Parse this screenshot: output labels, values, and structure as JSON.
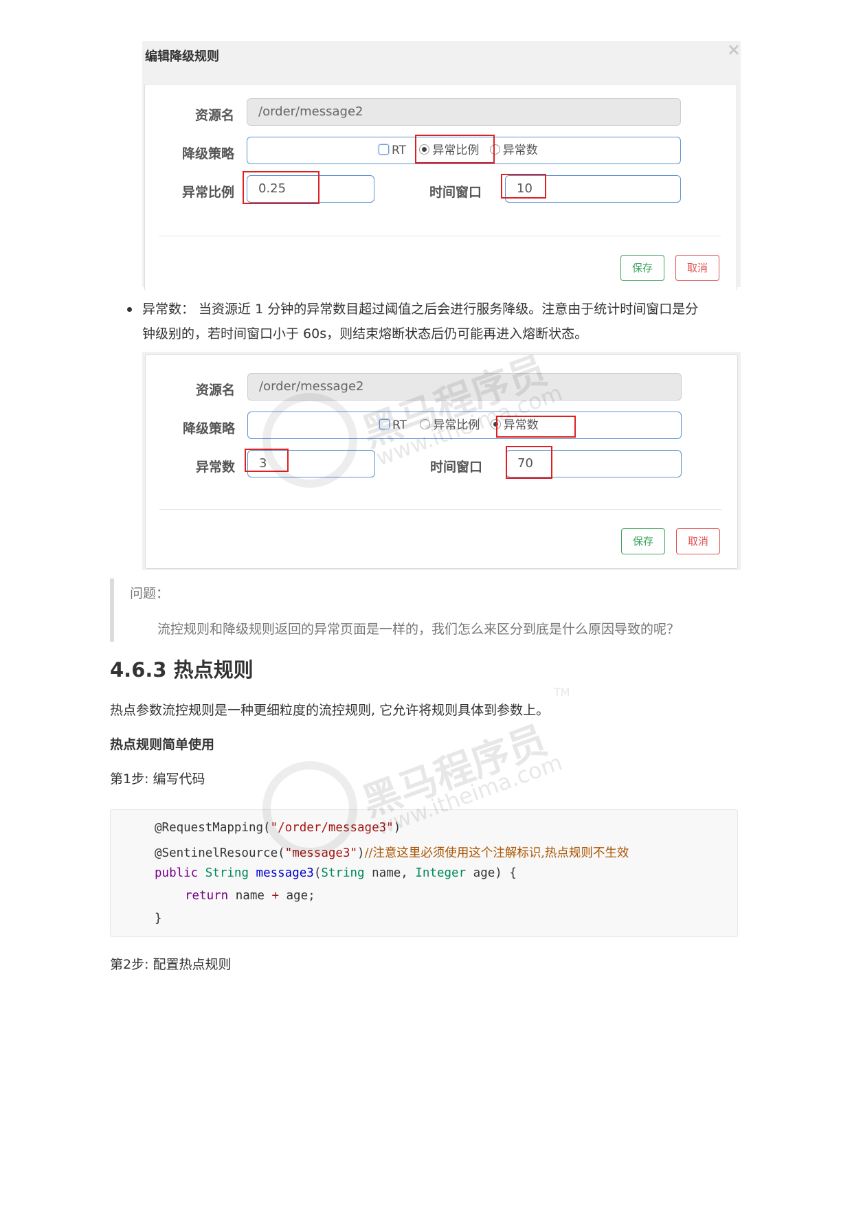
{
  "shot1": {
    "title": "编辑降级规则",
    "close": "×",
    "resource_label": "资源名",
    "resource_value": "/order/message2",
    "strategy_label": "降级策略",
    "options": [
      "RT",
      "异常比例",
      "异常数"
    ],
    "selected": "异常比例",
    "ratio_label": "异常比例",
    "ratio_value": "0.25",
    "window_label": "时间窗口",
    "window_value": "10",
    "save": "保存",
    "cancel": "取消"
  },
  "bullet_text_1": "异常数： 当资源近 1 分钟的异常数目超过阈值之后会进行服务降级。注意由于统计时间窗口是分",
  "bullet_text_2": "钟级别的，若时间窗口小于 60s，则结束熔断状态后仍可能再进入熔断状态。",
  "shot2": {
    "resource_label": "资源名",
    "resource_value": "/order/message2",
    "strategy_label": "降级策略",
    "options": [
      "RT",
      "异常比例",
      "异常数"
    ],
    "selected": "异常数",
    "count_label": "异常数",
    "count_value": "3",
    "window_label": "时间窗口",
    "window_value": "70",
    "save": "保存",
    "cancel": "取消"
  },
  "quote": {
    "label": "问题：",
    "text": "流控规则和降级规则返回的异常页面是一样的，我们怎么来区分到底是什么原因导致的呢？"
  },
  "section": {
    "heading": "4.6.3 热点规则",
    "intro": "热点参数流控规则是一种更细粒度的流控规则, 它允许将规则具体到参数上。",
    "subheading": "热点规则简单使用",
    "step1": "第1步: 编写代码",
    "step2": "第2步: 配置热点规则"
  },
  "code": {
    "l1a": "@RequestMapping(",
    "l1b": "\"/order/message3\"",
    "l1c": ")",
    "l2a": "@SentinelResource(",
    "l2b": "\"message3\"",
    "l2c": ")",
    "l2d": "//注意这里必须使用这个注解标识,热点规则不生效",
    "l3a": "public",
    "l3b": "String",
    "l3c": "message3",
    "l3d": "(",
    "l3e": "String",
    "l3f": " name, ",
    "l3g": "Integer",
    "l3h": " age) {",
    "l4a": "return",
    "l4b": " name ",
    "l4c": "+",
    "l4d": " age;",
    "l5": "}"
  },
  "watermark": {
    "brand": "黑马程序员",
    "url": "www.itheima.com",
    "tm": "TM"
  }
}
